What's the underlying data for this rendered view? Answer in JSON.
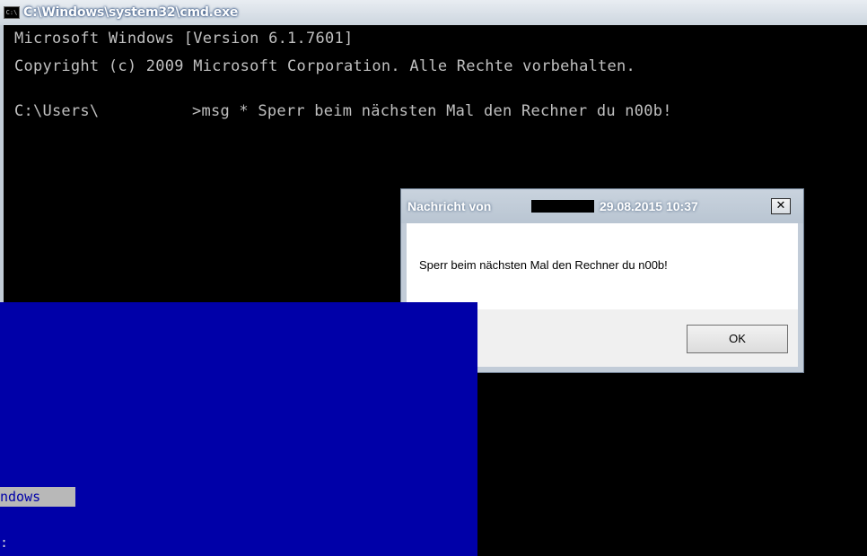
{
  "cmd": {
    "title": "C:\\Windows\\system32\\cmd.exe",
    "icon": "cmd-app-icon",
    "line1": "Microsoft Windows [Version 6.1.7601]",
    "line2": "Copyright (c) 2009 Microsoft Corporation. Alle Rechte vorbehalten.",
    "prompt_prefix": "C:\\Users\\",
    "prompt_command": ">msg * Sperr beim nächsten Mal den Rechner du n00b!",
    "colors": {
      "background": "#000000",
      "text": "#c0c0c0"
    }
  },
  "dialog": {
    "title_prefix": "Nachricht von",
    "title_datetime": "29.08.2015 10:37",
    "close_glyph": "✕",
    "message": "Sperr beim nächsten Mal den Rechner du n00b!",
    "ok_label": "OK"
  },
  "blue_screen": {
    "highlight_text": "ndows",
    "prompt_text": ":",
    "colors": {
      "background": "#0000a8",
      "highlight": "#b8b8b8"
    }
  }
}
